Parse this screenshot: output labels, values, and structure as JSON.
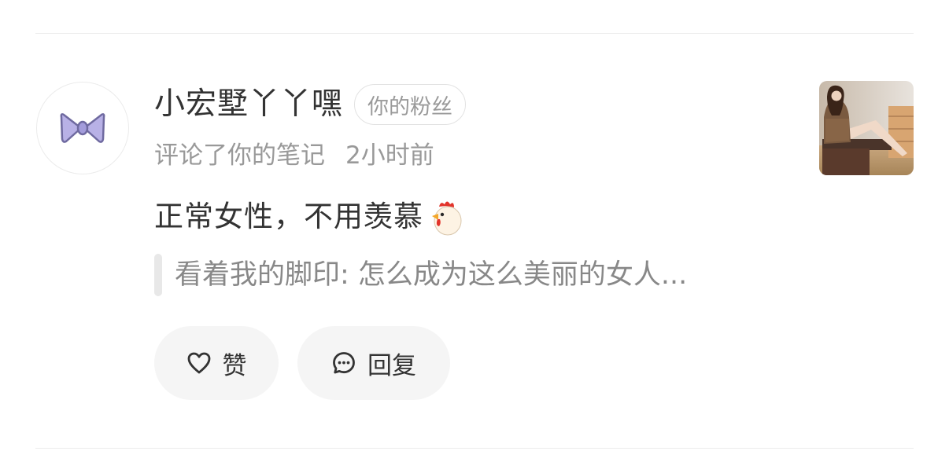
{
  "notification": {
    "username": "小宏墅丫丫嘿",
    "badge": "你的粉丝",
    "action": "评论了你的笔记",
    "time": "2小时前",
    "comment": "正常女性，不用羡慕",
    "comment_emoji": "chicken-emoji",
    "quoted_text": "看着我的脚印: 怎么成为这么美丽的女人...",
    "avatar_icon": "bow-icon",
    "accent_colors": {
      "text_primary": "#333333",
      "text_secondary": "#999999",
      "pill_bg": "#f5f5f5"
    }
  },
  "actions": {
    "like_label": "赞",
    "reply_label": "回复"
  }
}
